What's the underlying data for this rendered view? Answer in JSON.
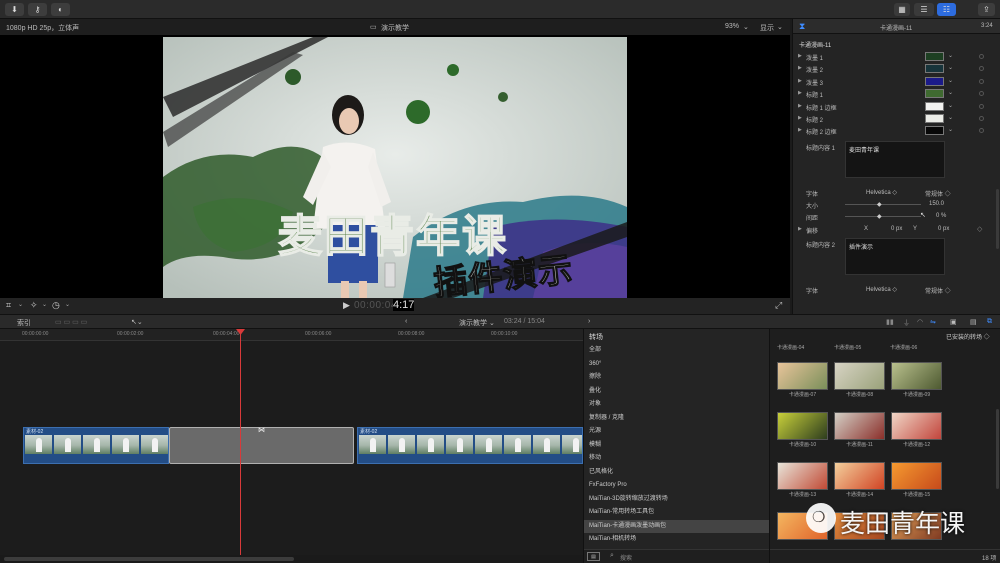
{
  "toolbar": {
    "import_icon": "⬇",
    "keys_icon": "⚷",
    "half_icon": "◐",
    "share_icon": "⇪"
  },
  "viewer": {
    "format": "1080p HD 25p，立体声",
    "title": "演示教学",
    "zoom": "93%",
    "view": "显示",
    "timecode": "00:00:04:17",
    "timecode_bright": "4:17"
  },
  "video": {
    "title_main": "麦田青年课",
    "title_sub": "插件演示"
  },
  "inspector": {
    "header_title": "卡通漫画-11",
    "duration": "3:24",
    "section": "卡通漫画-11",
    "params": [
      {
        "label": "泼墨 1",
        "color": "#1d3f22"
      },
      {
        "label": "泼墨 2",
        "color": "#17343b"
      },
      {
        "label": "泼墨 3",
        "color": "#1b1a8a"
      },
      {
        "label": "标题 1",
        "color": "#3f6a30"
      },
      {
        "label": "标题 1 边框",
        "color": "#f2f2f0"
      },
      {
        "label": "标题 2",
        "color": "#ecede8"
      },
      {
        "label": "标题 2 边框",
        "color": "#080808"
      }
    ],
    "content1_label": "标题内容 1",
    "content1_value": "麦田青年课",
    "font_label": "字体",
    "font_value": "Helvetica ◇",
    "style_value": "常规体 ◇",
    "size_label": "大小",
    "size_value": "150.0",
    "spacing_label": "间距",
    "spacing_value": "0 %",
    "offset_label": "偏移",
    "offset_x_label": "X",
    "offset_x_value": "0 px",
    "offset_y_label": "Y",
    "offset_y_value": "0 px",
    "content2_label": "标题内容 2",
    "content2_value": "插件演示",
    "font2_label": "字体",
    "font2_value": "Helvetica ◇",
    "style2_value": "常规体 ◇"
  },
  "timeline_header": {
    "index": "索引",
    "project": "演示教学 ⌄",
    "position": "03:24 / 15:04",
    "browser_title": "转场",
    "installed": "已安装的转场 ◇"
  },
  "ruler": [
    "00:00:00:00",
    "00:00:02:00",
    "00:00:04:00",
    "00:00:06:00",
    "00:00:08:00",
    "00:00:10:00"
  ],
  "clips": [
    {
      "name": "素材-02"
    },
    {
      "name": "素材-02"
    }
  ],
  "categories": [
    "全部",
    "360°",
    "擦除",
    "叠化",
    "对象",
    "复制器 / 克隆",
    "光源",
    "模糊",
    "移动",
    "已风格化",
    "FxFactory Pro",
    "MaiTian-3D旋转缩放过渡转场",
    "MaiTian-常用转场工具包",
    "MaiTian-卡通漫画泼墨动画包",
    "MaiTian-相机转场"
  ],
  "grid": {
    "top_labels": [
      "卡通漫画-04",
      "卡通漫画-05",
      "卡通漫画-06"
    ],
    "items": [
      {
        "cap": "卡通漫画-07",
        "c1": "#e8c49a",
        "c2": "#7a8f5a"
      },
      {
        "cap": "卡通漫画-08",
        "c1": "#d7d3c4",
        "c2": "#9aa27a"
      },
      {
        "cap": "卡通漫画-09",
        "c1": "#b9c08d",
        "c2": "#4e5a31"
      },
      {
        "cap": "卡通漫画-10",
        "c1": "#c8d03a",
        "c2": "#2d3d1e"
      },
      {
        "cap": "卡通漫画-11",
        "c1": "#d3cfc5",
        "c2": "#8b2f2a"
      },
      {
        "cap": "卡通漫画-12",
        "c1": "#f0d6c6",
        "c2": "#c2453c"
      },
      {
        "cap": "卡通漫画-13",
        "c1": "#e8e4d9",
        "c2": "#c14a35"
      },
      {
        "cap": "卡通漫画-14",
        "c1": "#f3cf9c",
        "c2": "#d14424"
      },
      {
        "cap": "卡通漫画-15",
        "c1": "#f59a30",
        "c2": "#c74a1b"
      },
      {
        "cap": "",
        "c1": "#f4b660",
        "c2": "#e0632a"
      },
      {
        "cap": "",
        "c1": "#e08a3c",
        "c2": "#a64721"
      },
      {
        "cap": "",
        "c1": "#e3a15a",
        "c2": "#7f3a22"
      }
    ]
  },
  "footer": {
    "search_placeholder": "搜索",
    "count": "18 项"
  },
  "watermark": "麦田青年课",
  "accent": "#2d6cdf",
  "playhead_color": "#d83a3a"
}
